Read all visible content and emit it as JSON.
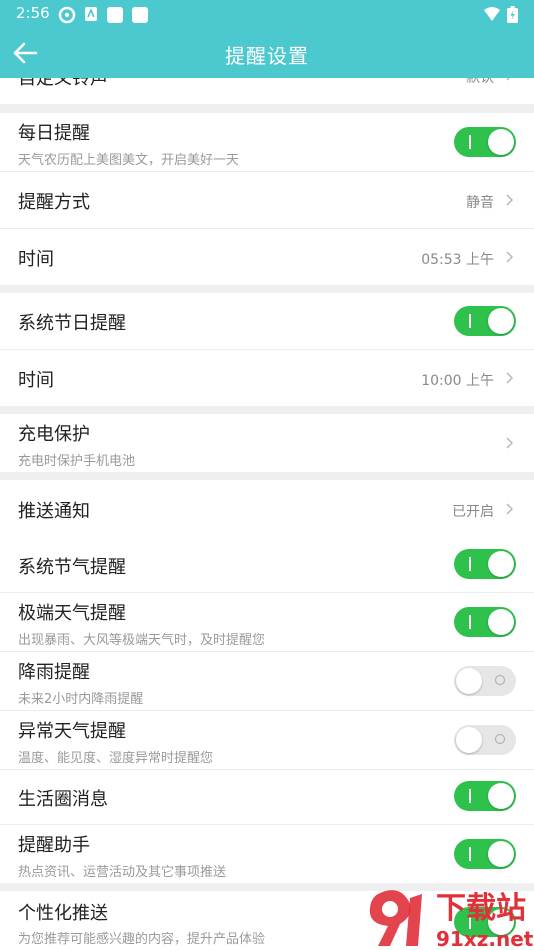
{
  "status": {
    "time": "2:56"
  },
  "header": {
    "title": "提醒设置"
  },
  "sections": {
    "ringtone": {
      "title": "自定义铃声",
      "value": "默认"
    },
    "daily": {
      "title": "每日提醒",
      "subtitle": "天气农历配上美图美文，开启美好一天",
      "toggle": "on",
      "mode_title": "提醒方式",
      "mode_value": "静音",
      "time_title": "时间",
      "time_value": "05:53 上午"
    },
    "holiday": {
      "title": "系统节日提醒",
      "toggle": "on",
      "time_title": "时间",
      "time_value": "10:00 上午"
    },
    "charging": {
      "title": "充电保护",
      "subtitle": "充电时保护手机电池"
    },
    "push": {
      "title": "推送通知",
      "value": "已开启",
      "solar_terms": {
        "title": "系统节气提醒",
        "toggle": "on"
      },
      "extreme": {
        "title": "极端天气提醒",
        "subtitle": "出现暴雨、大风等极端天气时，及时提醒您",
        "toggle": "on"
      },
      "rain": {
        "title": "降雨提醒",
        "subtitle": "未来2小时内降雨提醒",
        "toggle": "off"
      },
      "abnormal": {
        "title": "异常天气提醒",
        "subtitle": "温度、能见度、湿度异常时提醒您",
        "toggle": "off"
      },
      "life": {
        "title": "生活圈消息",
        "toggle": "on"
      },
      "assistant": {
        "title": "提醒助手",
        "subtitle": "热点资讯、运营活动及其它事项推送",
        "toggle": "on"
      }
    },
    "personalized": {
      "title": "个性化推送",
      "subtitle": "为您推荐可能感兴趣的内容，提升产品体验"
    }
  },
  "watermark": {
    "brand": "下载站",
    "site": "91xz.net"
  },
  "colors": {
    "accent": "#4cc8cf",
    "toggle_on": "#2ec24d",
    "toggle_off": "#e6e6e6",
    "watermark_red": "#e0303a"
  },
  "icons": [
    "back-arrow-icon",
    "chevron-right-icon",
    "wifi-icon",
    "battery-icon",
    "notification-icon"
  ]
}
